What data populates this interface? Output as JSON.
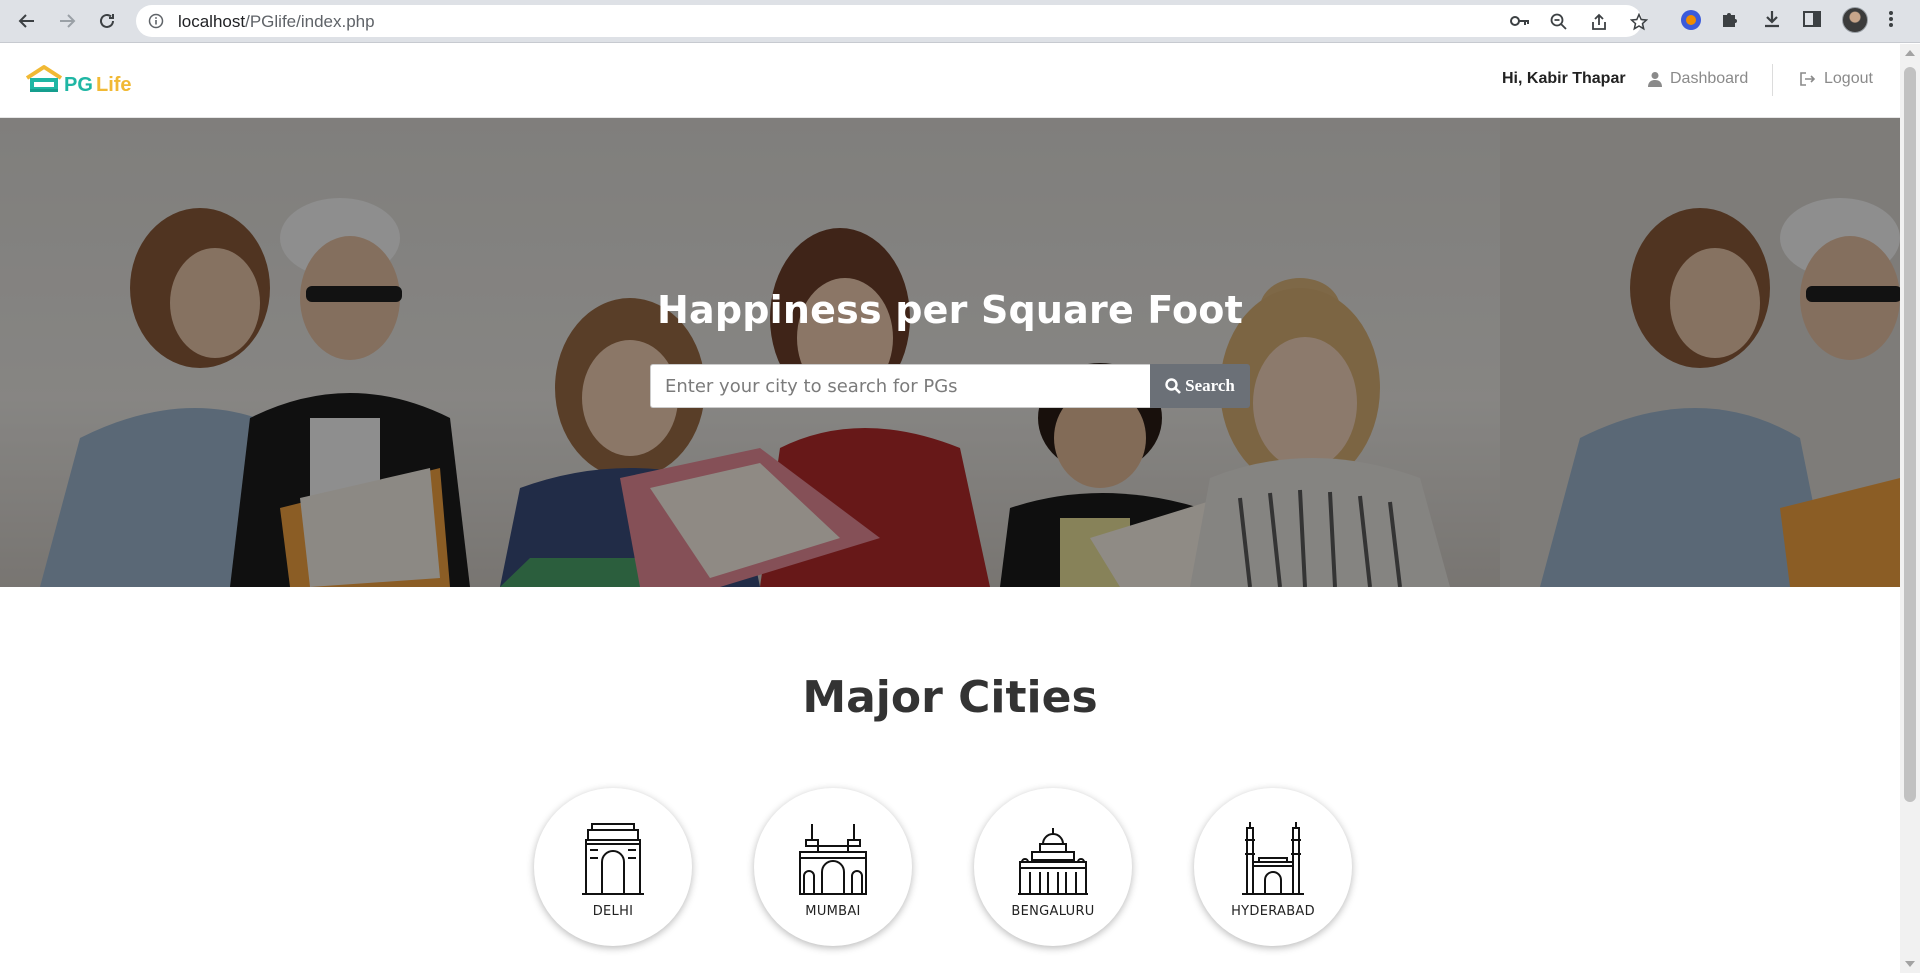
{
  "browser": {
    "url_host": "localhost",
    "url_path": "/PGlife/index.php"
  },
  "navbar": {
    "logo_pg": "PG",
    "logo_life": "Life",
    "greeting": "Hi, Kabir Thapar",
    "dashboard_label": "Dashboard",
    "logout_label": "Logout"
  },
  "banner": {
    "title": "Happiness per Square Foot",
    "search_placeholder": "Enter your city to search for PGs",
    "search_button": "Search"
  },
  "major_cities": {
    "title": "Major Cities",
    "cities": [
      {
        "name": "DELHI",
        "icon": "india-gate-icon"
      },
      {
        "name": "MUMBAI",
        "icon": "gateway-of-india-icon"
      },
      {
        "name": "BENGALURU",
        "icon": "vidhana-soudha-icon"
      },
      {
        "name": "HYDERABAD",
        "icon": "charminar-icon"
      }
    ]
  },
  "colors": {
    "brand_teal": "#1fb6a4",
    "brand_yellow": "#f1b934",
    "search_button_bg": "#6b7077"
  }
}
